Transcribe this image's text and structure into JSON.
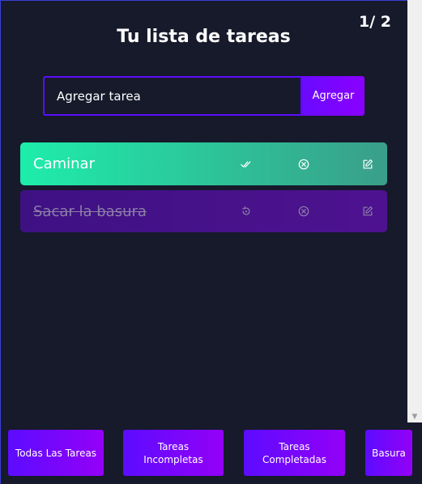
{
  "header": {
    "counter": "1/ 2",
    "title": "Tu lista de tareas"
  },
  "add_form": {
    "input_value": "Agregar tarea",
    "button_label": "Agregar"
  },
  "tasks": [
    {
      "text": "Caminar",
      "completed": false,
      "icons": [
        "double-check-icon",
        "circle-x-icon",
        "edit-icon"
      ]
    },
    {
      "text": "Sacar la basura",
      "completed": true,
      "icons": [
        "undo-icon",
        "circle-x-icon",
        "edit-icon"
      ]
    }
  ],
  "filters": [
    {
      "label": "Todas Las Tareas"
    },
    {
      "label": "Tareas Incompletas"
    },
    {
      "label": "Tareas Completadas"
    },
    {
      "label": "Basura"
    }
  ],
  "colors": {
    "background": "#161a2b",
    "accent": "#5d0cff",
    "task_active": "#1eedaa",
    "task_done": "#3e1183"
  }
}
